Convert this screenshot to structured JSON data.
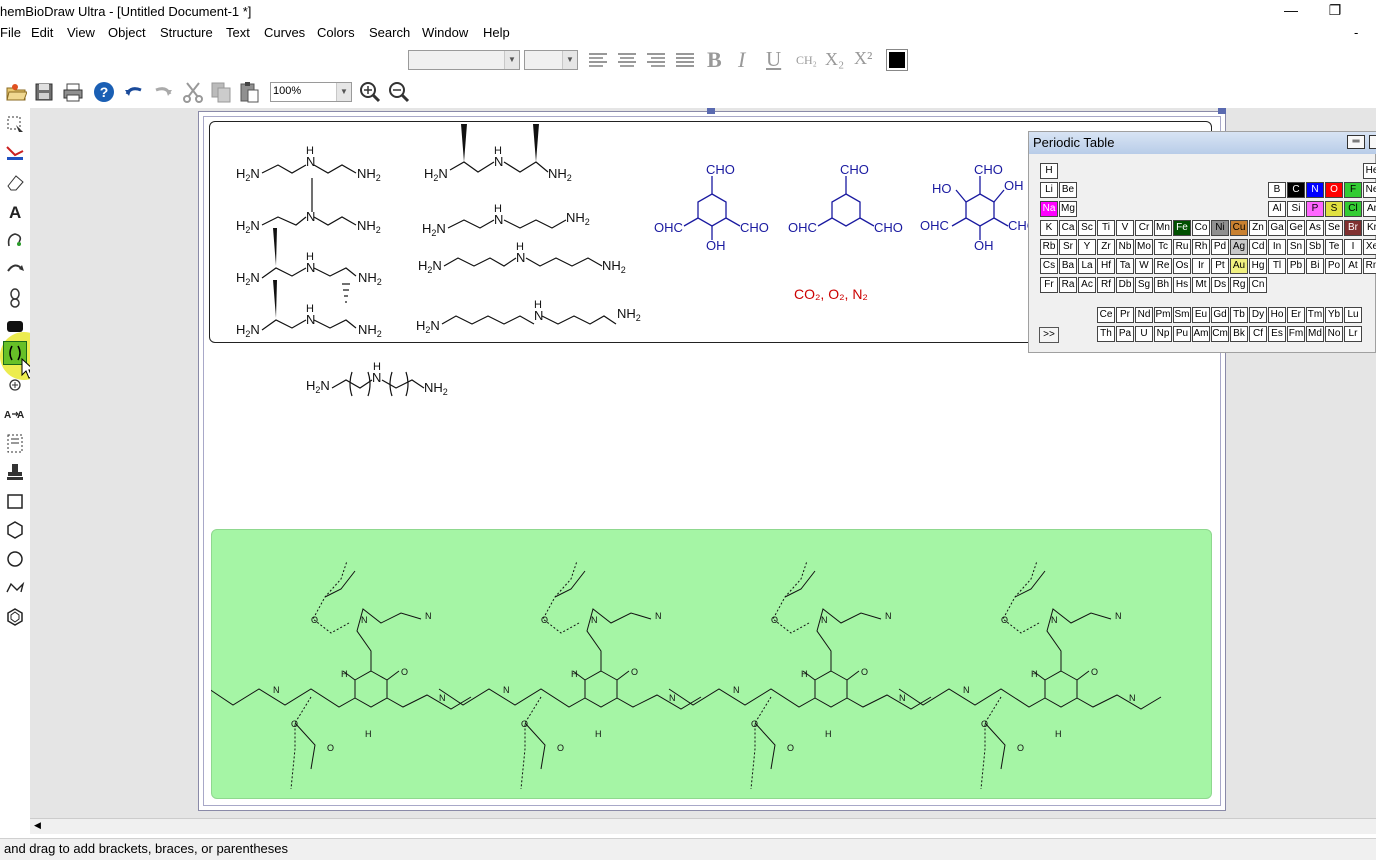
{
  "window": {
    "title": "hemBioDraw Ultra - [Untitled Document-1 *]",
    "minimize": "—",
    "restore": "❐"
  },
  "menu": [
    "File",
    "Edit",
    "View",
    "Object",
    "Structure",
    "Text",
    "Curves",
    "Colors",
    "Search",
    "Window",
    "Help"
  ],
  "menu_right": "-",
  "toolbar": {
    "zoom_value": "100%",
    "text_style_labels": [
      "B",
      "I",
      "U",
      "CH₂",
      "X₂",
      "X²"
    ]
  },
  "status_text": "and drag to add brackets, braces, or parentheses",
  "periodic_table": {
    "title": "Periodic Table",
    "more_button": ">>",
    "rows": [
      [
        "H",
        "",
        "",
        "",
        "",
        "",
        "",
        "",
        "",
        "",
        "",
        "",
        "",
        "",
        "",
        "",
        "",
        "He"
      ],
      [
        "Li",
        "Be",
        "",
        "",
        "",
        "",
        "",
        "",
        "",
        "",
        "",
        "",
        "B",
        "C",
        "N",
        "O",
        "F",
        "Ne"
      ],
      [
        "Na",
        "Mg",
        "",
        "",
        "",
        "",
        "",
        "",
        "",
        "",
        "",
        "",
        "Al",
        "Si",
        "P",
        "S",
        "Cl",
        "Ar"
      ],
      [
        "K",
        "Ca",
        "Sc",
        "Ti",
        "V",
        "Cr",
        "Mn",
        "Fe",
        "Co",
        "Ni",
        "Cu",
        "Zn",
        "Ga",
        "Ge",
        "As",
        "Se",
        "Br",
        "Kr"
      ],
      [
        "Rb",
        "Sr",
        "Y",
        "Zr",
        "Nb",
        "Mo",
        "Tc",
        "Ru",
        "Rh",
        "Pd",
        "Ag",
        "Cd",
        "In",
        "Sn",
        "Sb",
        "Te",
        "I",
        "Xe"
      ],
      [
        "Cs",
        "Ba",
        "La",
        "Hf",
        "Ta",
        "W",
        "Re",
        "Os",
        "Ir",
        "Pt",
        "Au",
        "Hg",
        "Tl",
        "Pb",
        "Bi",
        "Po",
        "At",
        "Rn"
      ],
      [
        "Fr",
        "Ra",
        "Ac",
        "Rf",
        "Db",
        "Sg",
        "Bh",
        "Hs",
        "Mt",
        "Ds",
        "Rg",
        "Cn",
        "",
        "",
        "",
        "",
        "",
        ""
      ]
    ],
    "lanthanides": [
      "Ce",
      "Pr",
      "Nd",
      "Pm",
      "Sm",
      "Eu",
      "Gd",
      "Tb",
      "Dy",
      "Ho",
      "Er",
      "Tm",
      "Yb",
      "Lu"
    ],
    "actinides": [
      "Th",
      "Pa",
      "U",
      "Np",
      "Pu",
      "Am",
      "Cm",
      "Bk",
      "Cf",
      "Es",
      "Fm",
      "Md",
      "No",
      "Lr"
    ],
    "colors": {
      "C": "#000000",
      "N": "#0000ff",
      "O": "#ff0000",
      "F": "#33cc33",
      "Cl": "#33cc33",
      "Na": "#ff00ff",
      "P": "#ff66ff",
      "S": "#e0e040",
      "Fe": "#005000",
      "Ni": "#909090",
      "Cu": "#c88030",
      "Br": "#803030",
      "Ag": "#c8c8c8",
      "Au": "#f0f080"
    }
  },
  "canvas": {
    "amine_labels": {
      "nh2": "NH2",
      "h2n": "H2N",
      "nh": "N",
      "h": "H"
    },
    "aldehyde_labels": {
      "cho": "CHO",
      "ohc": "OHC",
      "oh": "OH",
      "ho": "HO"
    },
    "gas_label": "CO₂, O₂, N₂",
    "gas_color": "#cc0000",
    "aldehyde_color": "#1a1aa0"
  }
}
